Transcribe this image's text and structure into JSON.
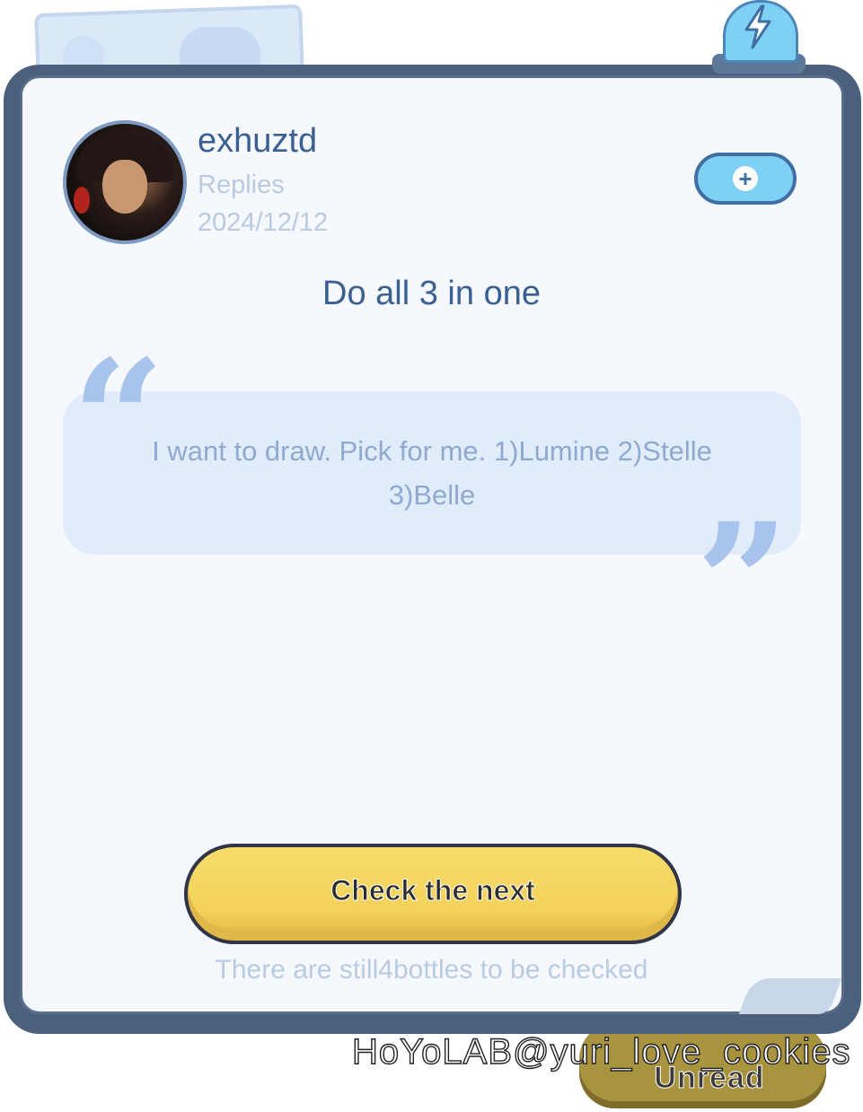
{
  "post": {
    "username": "exhuztd",
    "subtitle": "Replies",
    "date": "2024/12/12",
    "title": "Do all 3 in one",
    "quote": "I want to draw. Pick for me. 1)Lumine 2)Stelle 3)Belle"
  },
  "actions": {
    "add_icon": "plus-icon",
    "next_label": "Check the next",
    "remaining_text": "There are still4bottles to be checked"
  },
  "badge": {
    "icon": "lightning-icon"
  },
  "unread": {
    "label": "Unread"
  },
  "watermark": "HoYoLAB@yuri_love_cookies",
  "colors": {
    "accent_blue": "#7fd0f5",
    "title_blue": "#3b5f91",
    "muted_text": "#b9cbe2",
    "button_yellow": "#f3d15a",
    "frame": "#4b607d"
  }
}
